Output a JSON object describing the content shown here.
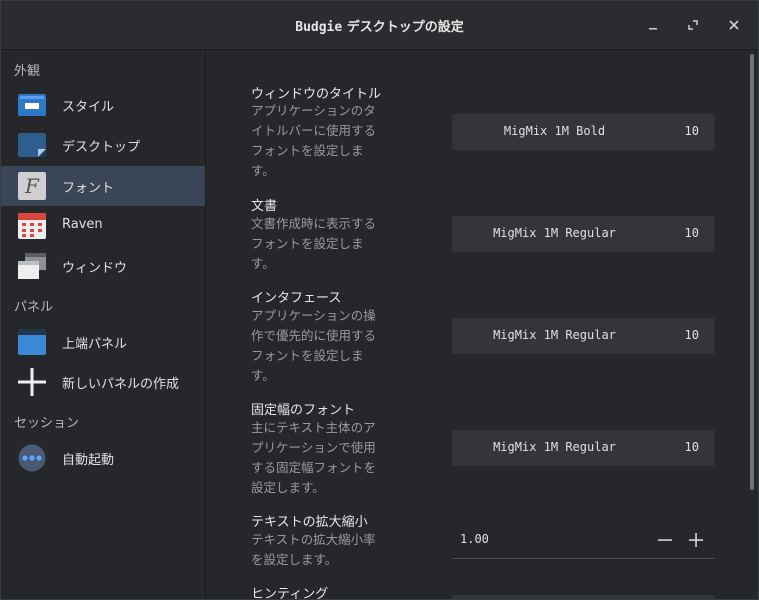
{
  "window": {
    "title_mono": "Budgie",
    "title_rest": " デスクトップの設定",
    "minimize_glyph": "−",
    "maximize_glyph": "⤢",
    "close_glyph": "✕"
  },
  "sidebar": {
    "sections": [
      {
        "header": "外観"
      },
      {
        "header": "パネル"
      },
      {
        "header": "セッション"
      }
    ],
    "items": [
      {
        "label": "スタイル",
        "icon": "style-icon"
      },
      {
        "label": "デスクトップ",
        "icon": "desktop-icon"
      },
      {
        "label": "フォント",
        "icon": "font-icon",
        "active": true
      },
      {
        "label": "Raven",
        "icon": "calendar-icon"
      },
      {
        "label": "ウィンドウ",
        "icon": "window-icon"
      },
      {
        "label": "上端パネル",
        "icon": "panel-icon"
      },
      {
        "label": "新しいパネルの作成",
        "icon": "add-icon"
      },
      {
        "label": "自動起動",
        "icon": "autostart-icon"
      }
    ]
  },
  "settings": [
    {
      "title": "ウィンドウのタイトル",
      "desc": [
        "アプリケーションのタ",
        "イトルバーに使用する",
        "フォントを設定しま",
        "す。"
      ],
      "font": "MigMix 1M Bold",
      "size": "10"
    },
    {
      "title": "文書",
      "desc": [
        "文書作成時に表示する",
        "フォントを設定しま",
        "す。"
      ],
      "font": "MigMix 1M Regular",
      "size": "10"
    },
    {
      "title": "インタフェース",
      "desc": [
        "アプリケーションの操",
        "作で優先的に使用する",
        "フォントを設定しま",
        "す。"
      ],
      "font": "MigMix 1M Regular",
      "size": "10"
    },
    {
      "title": "固定幅のフォント",
      "desc": [
        "主にテキスト主体のア",
        "プリケーションで使用",
        "する固定幅フォントを",
        "設定します。"
      ],
      "font": "MigMix 1M Regular",
      "size": "10"
    },
    {
      "title": "テキストの拡大縮小",
      "desc": [
        "テキストの拡大縮小率",
        "を設定します。"
      ],
      "value": "1.00",
      "minus": "−",
      "plus": "+"
    },
    {
      "title": "ヒンティング"
    }
  ],
  "colors": {
    "active_bg": "#3a4658",
    "button_bg": "#333538",
    "window_bg": "#25272a"
  }
}
